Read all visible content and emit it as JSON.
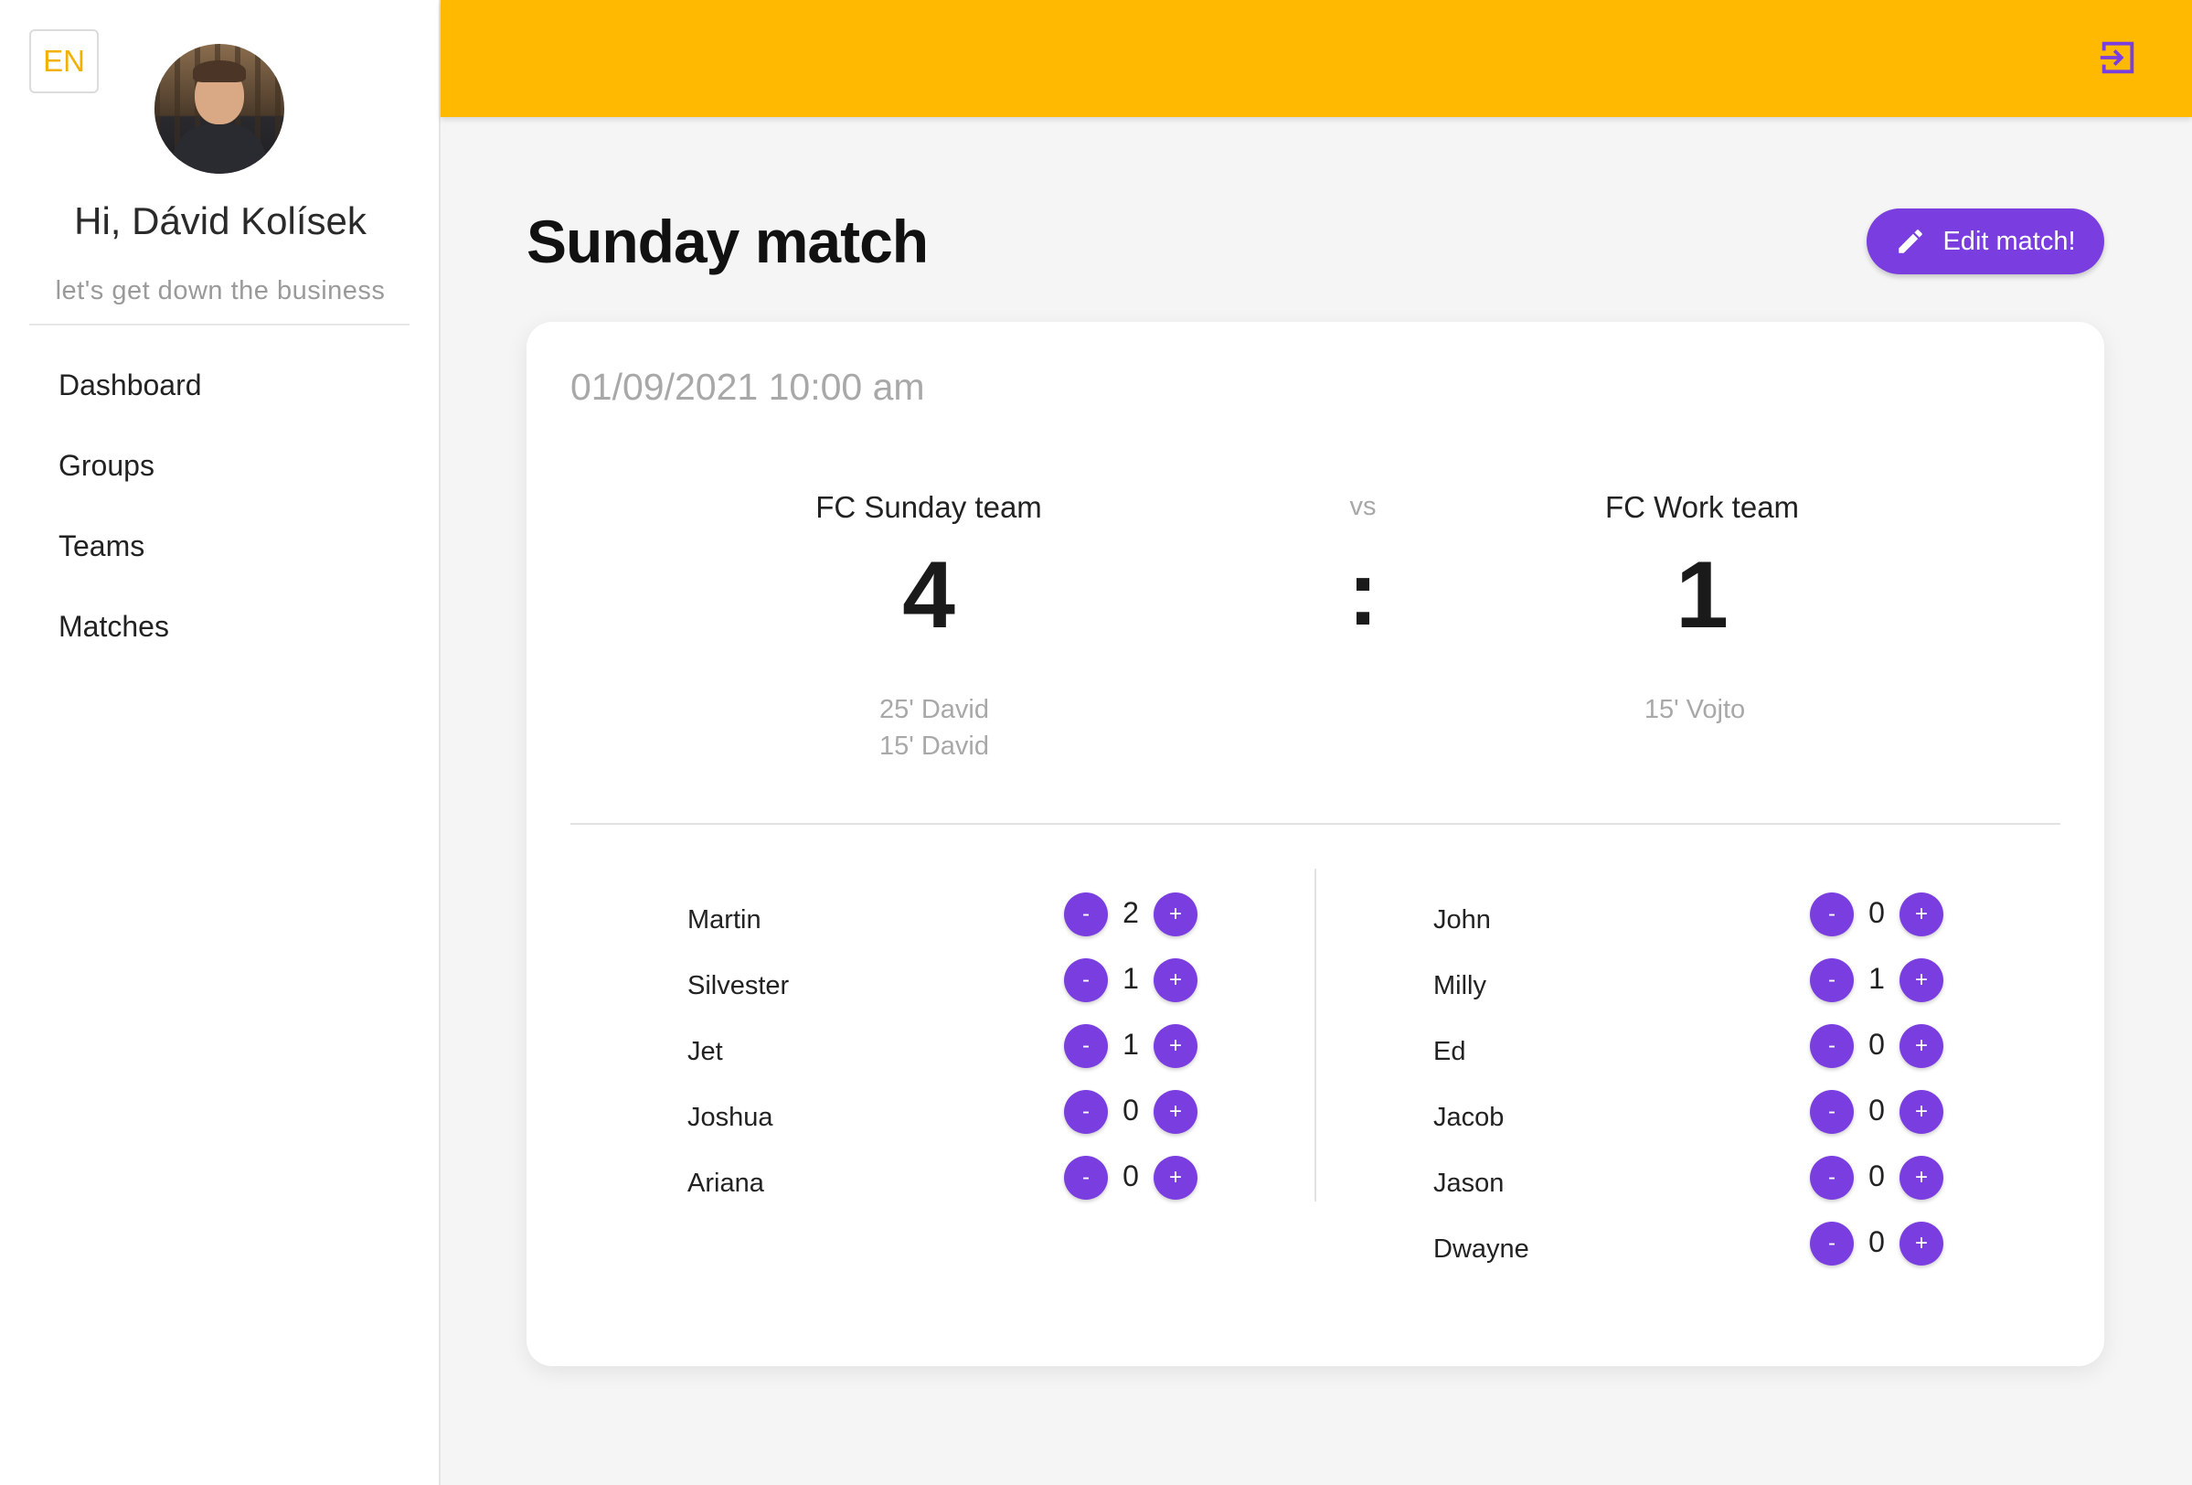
{
  "sidebar": {
    "language": "EN",
    "greeting": "Hi, Dávid Kolísek",
    "tagline": "let's get down the business",
    "nav": [
      "Dashboard",
      "Groups",
      "Teams",
      "Matches"
    ]
  },
  "header": {
    "accent_color": "#ffb900",
    "logout_icon": "logout-icon"
  },
  "page": {
    "title": "Sunday match",
    "edit_label": "Edit match!",
    "button_color": "#7a3ee0"
  },
  "match": {
    "datetime": "01/09/2021 10:00 am",
    "vs": "vs",
    "separator": ":",
    "home": {
      "name": "FC Sunday team",
      "score": "4",
      "scorers": [
        "25' David",
        "15' David"
      ],
      "players": [
        {
          "name": "Martin",
          "goals": "2"
        },
        {
          "name": "Silvester",
          "goals": "1"
        },
        {
          "name": "Jet",
          "goals": "1"
        },
        {
          "name": "Joshua",
          "goals": "0"
        },
        {
          "name": "Ariana",
          "goals": "0"
        }
      ]
    },
    "away": {
      "name": "FC Work team",
      "score": "1",
      "scorers": [
        "15' Vojto"
      ],
      "players": [
        {
          "name": "John",
          "goals": "0"
        },
        {
          "name": "Milly",
          "goals": "1"
        },
        {
          "name": "Ed",
          "goals": "0"
        },
        {
          "name": "Jacob",
          "goals": "0"
        },
        {
          "name": "Jason",
          "goals": "0"
        },
        {
          "name": "Dwayne",
          "goals": "0"
        }
      ]
    },
    "minus_label": "-",
    "plus_label": "+"
  }
}
